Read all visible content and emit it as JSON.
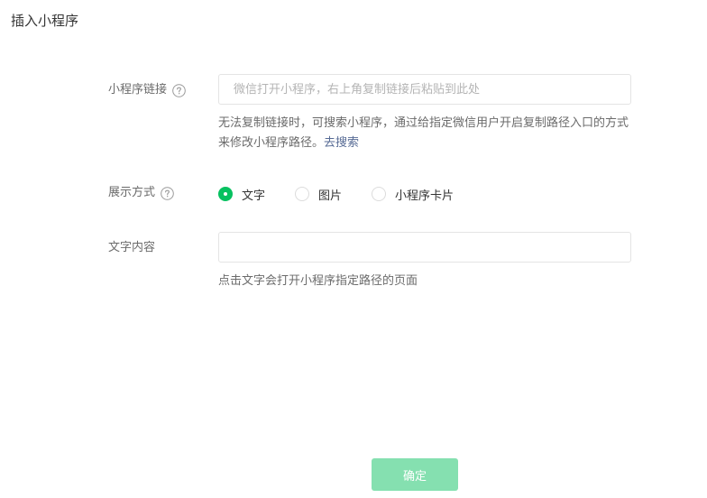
{
  "dialog": {
    "title": "插入小程序"
  },
  "miniprogram_link": {
    "label": "小程序链接",
    "help_icon": "question-circle-icon",
    "placeholder": "微信打开小程序，右上角复制链接后粘贴到此处",
    "value": "",
    "hint": "无法复制链接时，可搜索小程序，通过给指定微信用户开启复制路径入口的方式来修改小程序路径。",
    "hint_link": "去搜索"
  },
  "display_mode": {
    "label": "展示方式",
    "help_icon": "question-circle-icon",
    "options": [
      {
        "label": "文字",
        "selected": true
      },
      {
        "label": "图片",
        "selected": false
      },
      {
        "label": "小程序卡片",
        "selected": false
      }
    ]
  },
  "text_content": {
    "label": "文字内容",
    "value": "",
    "hint": "点击文字会打开小程序指定路径的页面"
  },
  "footer": {
    "confirm_label": "确定",
    "confirm_enabled": false
  },
  "colors": {
    "accent": "#07c160",
    "link": "#576b95",
    "disabled_button": "#85e0b0"
  }
}
